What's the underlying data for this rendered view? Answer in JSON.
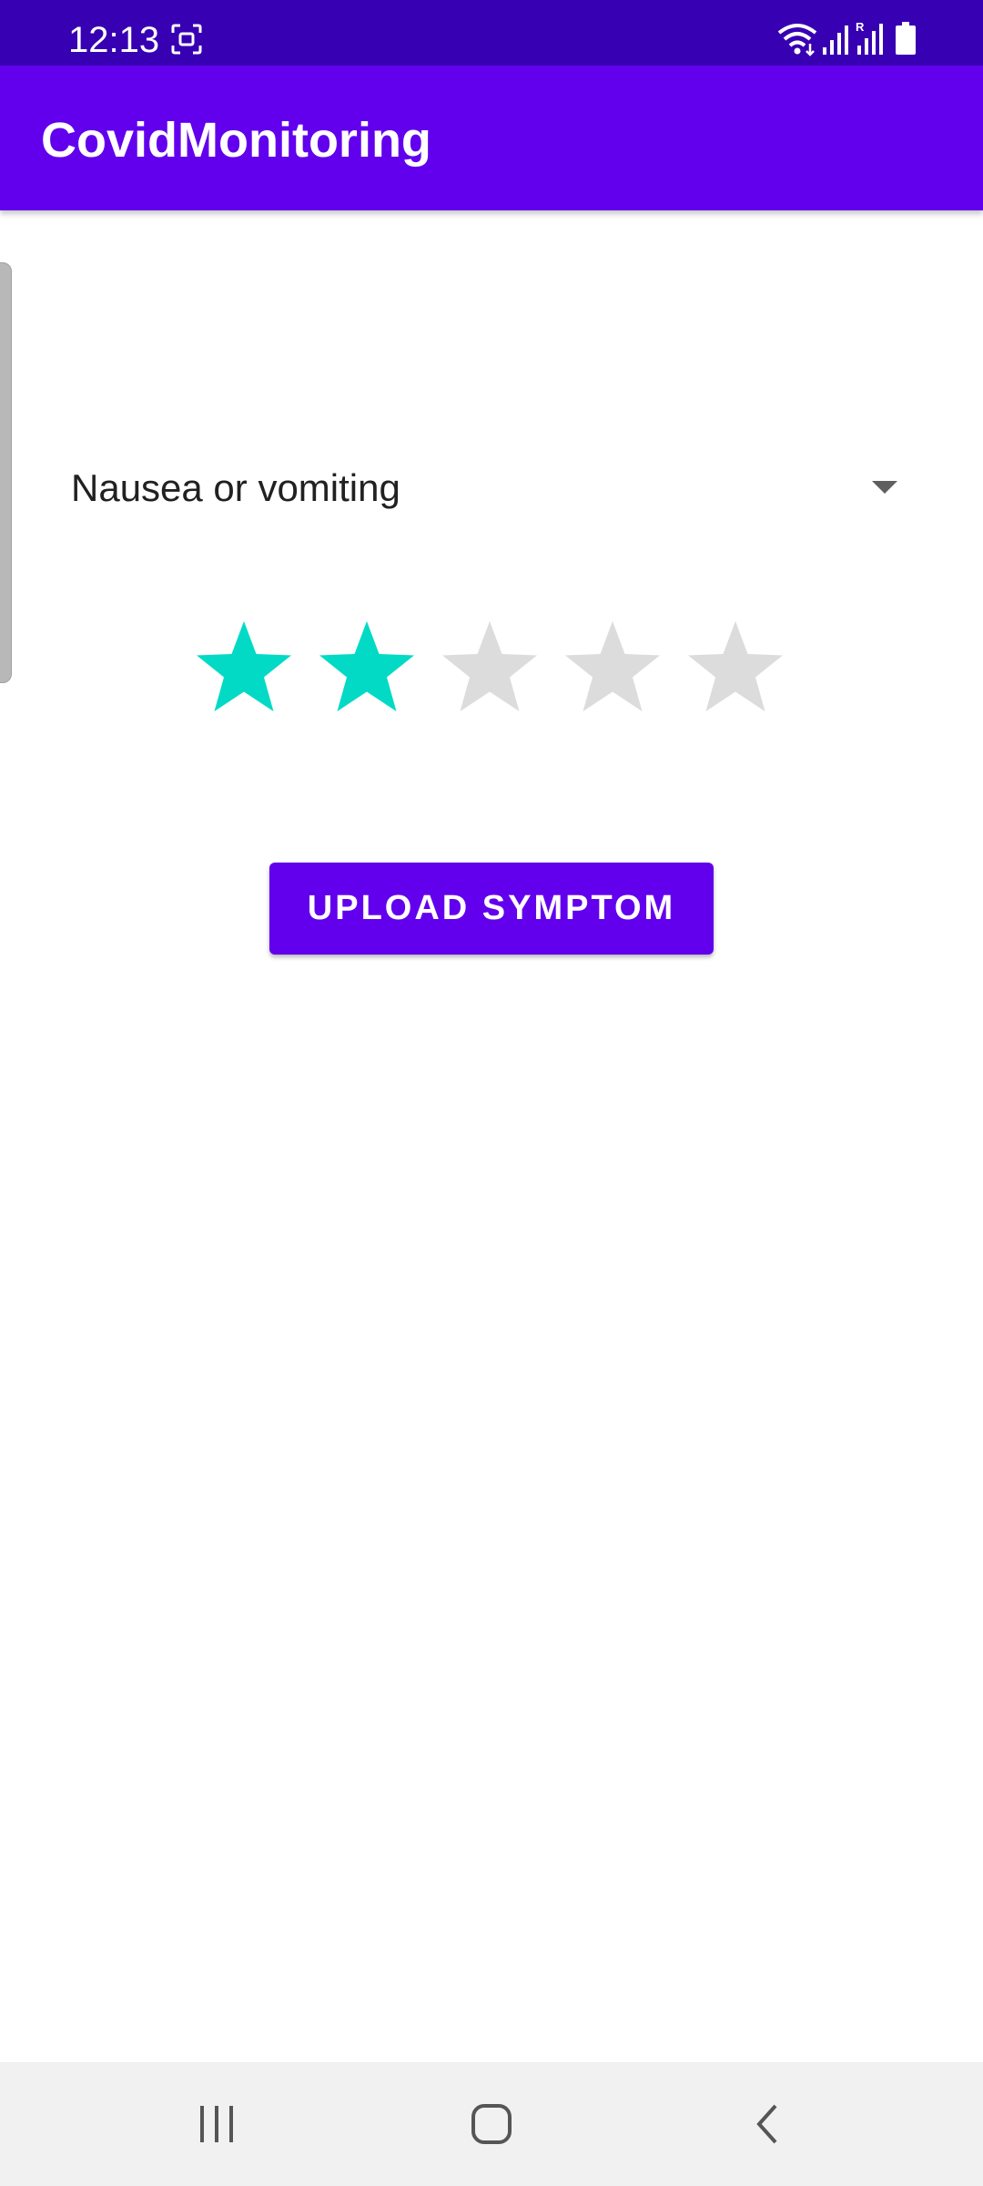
{
  "status_bar": {
    "time": "12:13",
    "icons": [
      "screen-capture-icon",
      "wifi-icon",
      "signal-icon",
      "signal-r-icon",
      "battery-icon"
    ]
  },
  "app_bar": {
    "title": "CovidMonitoring",
    "color": "#6200ee"
  },
  "symptom_spinner": {
    "selected": "Nausea or vomiting",
    "icon": "dropdown-arrow-icon"
  },
  "rating": {
    "value": 2,
    "max": 5,
    "filled_color": "#03dac5",
    "empty_color": "#dcdcdc"
  },
  "upload_button": {
    "label": "UPLOAD SYMPTOM"
  },
  "nav_bar": {
    "icons": [
      "recent-apps-icon",
      "home-icon",
      "back-icon"
    ]
  },
  "colors": {
    "status_bar": "#3700b3",
    "primary": "#6200ee",
    "accent": "#03dac5"
  }
}
